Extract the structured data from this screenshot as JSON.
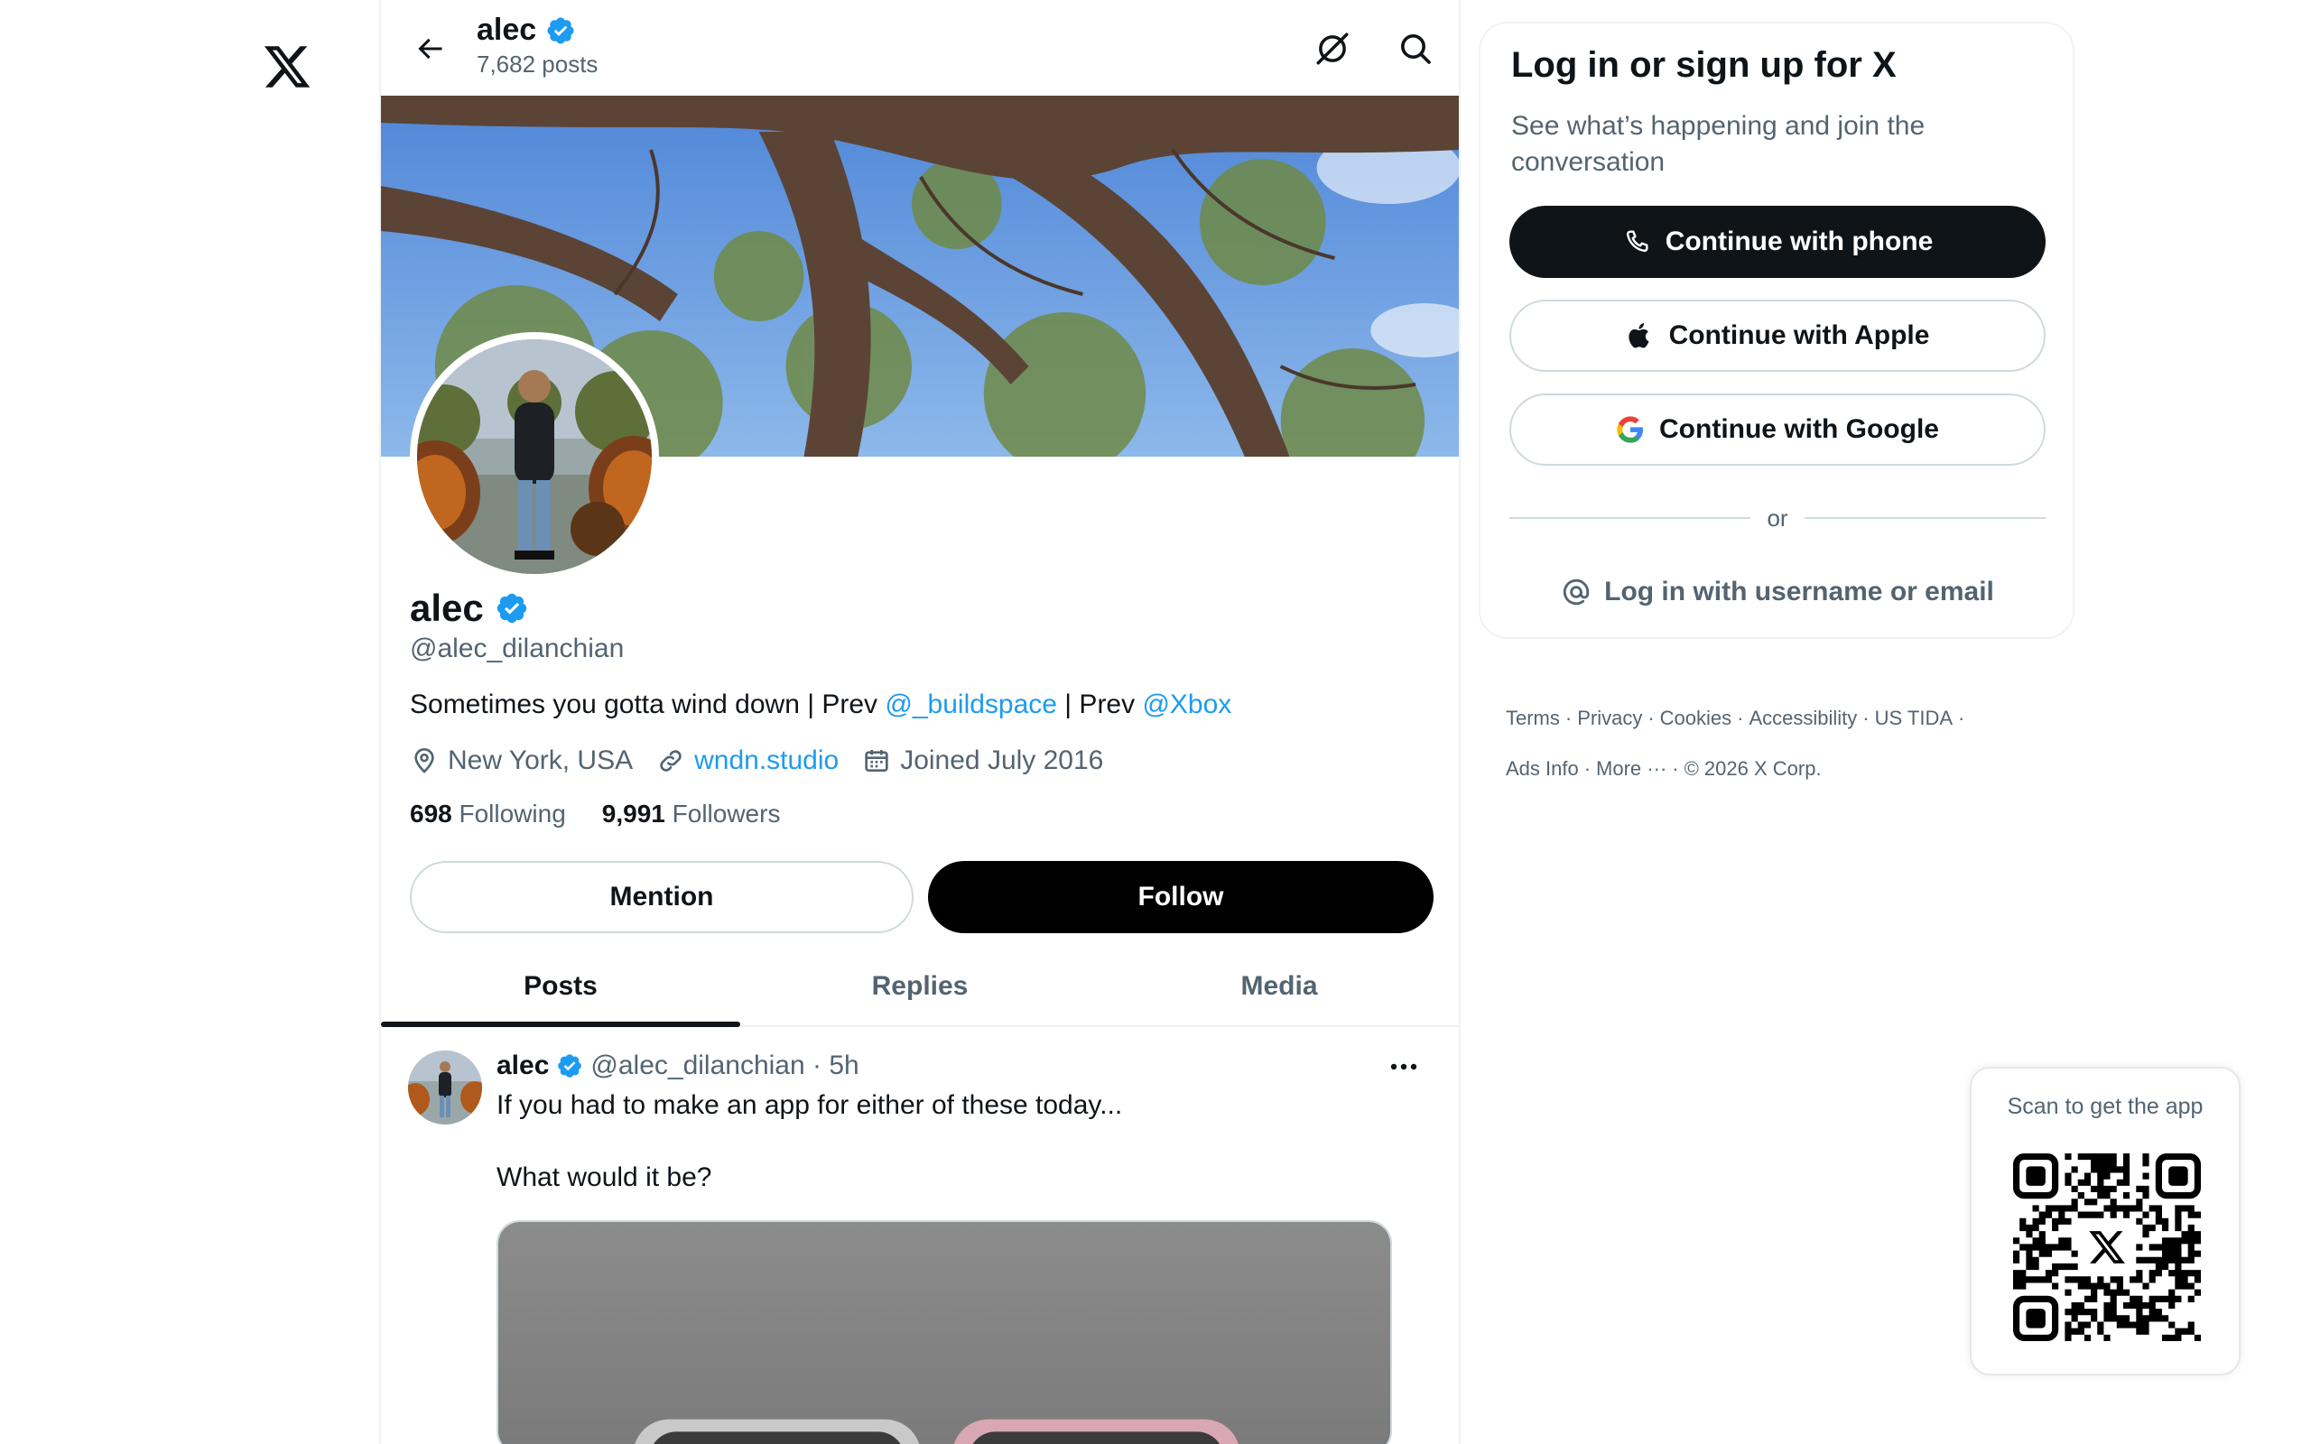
{
  "left_rail": {
    "logo_icon": "x-logo-icon"
  },
  "header": {
    "name": "alec",
    "post_count": "7,682 posts"
  },
  "profile": {
    "name": "alec",
    "handle": "@alec_dilanchian",
    "bio_prefix": "Sometimes you gotta wind down | Prev ",
    "bio_mention_1": "@_buildspace",
    "bio_mid": " | Prev ",
    "bio_mention_2": "@Xbox",
    "location": "New York, USA",
    "website": "wndn.studio",
    "joined": "Joined July 2016",
    "following_count": "698",
    "following_label": "Following",
    "followers_count": "9,991",
    "followers_label": "Followers",
    "mention_label": "Mention",
    "follow_label": "Follow"
  },
  "tabs": [
    {
      "label": "Posts",
      "active": true
    },
    {
      "label": "Replies",
      "active": false
    },
    {
      "label": "Media",
      "active": false
    }
  ],
  "post": {
    "author": "alec",
    "handle_time": "@alec_dilanchian · 5h",
    "text_line_1": "If you had to make an app for either of these today...",
    "text_line_2": "What would it be?"
  },
  "login": {
    "title": "Log in or sign up for X",
    "subtitle": "See what’s happening and join the conversation",
    "phone_label": "Continue with phone",
    "apple_label": "Continue with Apple",
    "google_label": "Continue with Google",
    "or_label": "or",
    "username_label": "Log in with username or email"
  },
  "footer": {
    "terms": "Terms",
    "privacy": "Privacy",
    "cookies": "Cookies",
    "accessibility": "Accessibility",
    "us_tida": "US TIDA",
    "ads_info": "Ads Info",
    "more": "More",
    "copyright": "© 2026 X Corp."
  },
  "qr": {
    "title": "Scan to get the app"
  },
  "colors": {
    "accent": "#1d9bf0",
    "text_primary": "#0f1419",
    "text_secondary": "#536471",
    "border": "#eff3f4",
    "button_dark": "#0f1419"
  }
}
